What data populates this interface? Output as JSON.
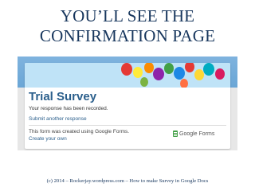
{
  "slide": {
    "title_line1": "YOU’LL SEE THE",
    "title_line2": "CONFIRMATION PAGE",
    "copyright": "(c) 2014 – Rockerjay.wordpress.com – How to make Survey in Google Docs"
  },
  "form": {
    "title": "Trial Survey",
    "response_message": "Your response has been recorded.",
    "submit_another": "Submit another response",
    "footer_note": "This form was created using Google Forms.",
    "create_own": "Create your own",
    "brand": "Google Forms",
    "brand_icon": "google-forms-icon"
  },
  "colors": {
    "title": "#17365d",
    "header_blue": "#6aa6d6",
    "banner": "#bfe3f7",
    "form_title": "#2b5f8c",
    "forms_green": "#43a047"
  }
}
